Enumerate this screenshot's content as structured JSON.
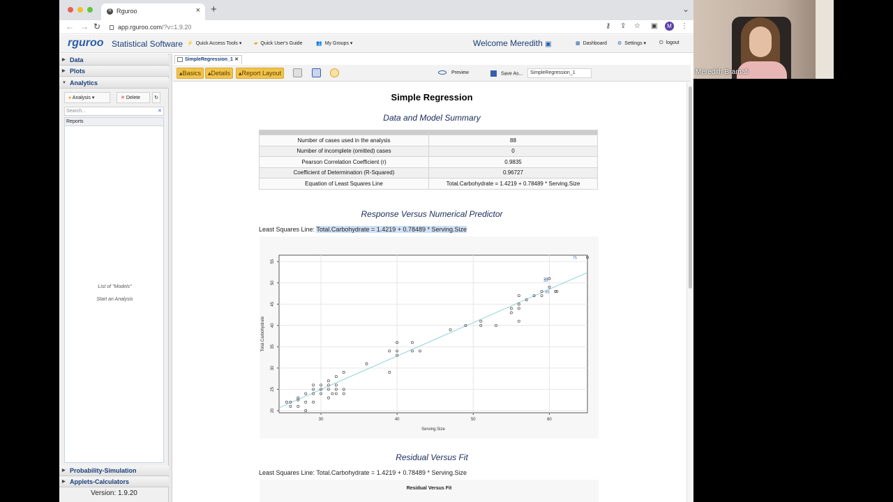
{
  "browser": {
    "tab_title": "Rguroo",
    "url_host": "app.rguroo.com",
    "url_path": "/?v=1.9.20"
  },
  "app": {
    "logo": "rguroo",
    "name": "Statistical Software",
    "quick_access": "Quick Access Tools",
    "users_guide": "Quick User's Guide",
    "my_groups": "My Groups",
    "welcome": "Welcome Meredith",
    "dashboard": "Dashboard",
    "settings": "Settings",
    "logout": "logout"
  },
  "sidebar": {
    "data": "Data",
    "plots": "Plots",
    "analytics": "Analytics",
    "analysis_btn": "Analysis",
    "delete_btn": "Delete",
    "search_placeholder": "Search...",
    "reports_header": "Reports",
    "empty_line1": "List of  \"Models\"",
    "empty_line2": "Start an Analysis",
    "prob_sim": "Probability-Simulation",
    "applets": "Applets-Calculators",
    "version": "Version: 1.9.20"
  },
  "document": {
    "tab_label": "SimpleRegression_1",
    "basics": "Basics",
    "details": "Details",
    "report_layout": "Report Layout",
    "preview": "Preview",
    "save_as": "Save As...",
    "filename": "SimpleRegression_1"
  },
  "report": {
    "title": "Simple Regression",
    "section1": "Data and Model Summary",
    "summary_rows": [
      {
        "label": "Number of cases used in the analysis",
        "value": "88"
      },
      {
        "label": "Number of incomplete (omitted) cases",
        "value": "0"
      },
      {
        "label": "Pearson Correlation Coefficient (r)",
        "value": "0.9835"
      },
      {
        "label": "Coefficient of Determination (R-Squared)",
        "value": "0.96727"
      },
      {
        "label": "Equation of Least Squares Line",
        "value": "Total.Carbohydrate = 1.4219 + 0.78489 * Serving.Size"
      }
    ],
    "section2": "Response Versus Numerical Predictor",
    "lsl_prefix": "Least Squares Line: ",
    "lsl_equation": "Total.Carbohydrate = 1.4219 + 0.78489 * Serving.Size",
    "section3": "Residual Versus Fit",
    "residual_plot_title": "Residual Versus Fit"
  },
  "webcam": {
    "name": "Meredith Bramati"
  },
  "chart_data": {
    "type": "scatter",
    "title": "",
    "xlabel": "Serving.Size",
    "ylabel": "Total.Carbohydrate",
    "xlim": [
      24.5,
      65
    ],
    "ylim": [
      19.5,
      56.5
    ],
    "xticks": [
      30,
      40,
      50,
      60
    ],
    "yticks": [
      20,
      25,
      30,
      35,
      40,
      45,
      50,
      55
    ],
    "grid": true,
    "fit_line": {
      "intercept": 1.4219,
      "slope": 0.78489,
      "color": "#8fd3d8"
    },
    "point_labels": [
      {
        "x": 60,
        "y": 50.9,
        "text": "29"
      },
      {
        "x": 60,
        "y": 50.6,
        "text": "33"
      },
      {
        "x": 60.2,
        "y": 47.9,
        "text": "65"
      },
      {
        "x": 63.8,
        "y": 55.9,
        "text": "75"
      }
    ],
    "points": [
      [
        25.5,
        22
      ],
      [
        26,
        22
      ],
      [
        26,
        21
      ],
      [
        27,
        23
      ],
      [
        27,
        22.5
      ],
      [
        27,
        21
      ],
      [
        28,
        22
      ],
      [
        28,
        20
      ],
      [
        28,
        24
      ],
      [
        29,
        22
      ],
      [
        29,
        24
      ],
      [
        29,
        25
      ],
      [
        29,
        26
      ],
      [
        30,
        24
      ],
      [
        30,
        25
      ],
      [
        30,
        26
      ],
      [
        31,
        23
      ],
      [
        31,
        25
      ],
      [
        31,
        26
      ],
      [
        31,
        27
      ],
      [
        31.5,
        24
      ],
      [
        32,
        25
      ],
      [
        32,
        26
      ],
      [
        32,
        28
      ],
      [
        32,
        24
      ],
      [
        33,
        24
      ],
      [
        33,
        25
      ],
      [
        33,
        29
      ],
      [
        36,
        31
      ],
      [
        39,
        29
      ],
      [
        39,
        34
      ],
      [
        40,
        33
      ],
      [
        40,
        34
      ],
      [
        40,
        36
      ],
      [
        42,
        34
      ],
      [
        42,
        36
      ],
      [
        43,
        34
      ],
      [
        47,
        39
      ],
      [
        49,
        40
      ],
      [
        51,
        40
      ],
      [
        51,
        41
      ],
      [
        53,
        40
      ],
      [
        55,
        43
      ],
      [
        55,
        44
      ],
      [
        56,
        41
      ],
      [
        56,
        44
      ],
      [
        56,
        45
      ],
      [
        56,
        47
      ],
      [
        57,
        46
      ],
      [
        58,
        47
      ],
      [
        59,
        47
      ],
      [
        59,
        48
      ],
      [
        60,
        49
      ],
      [
        60,
        51
      ],
      [
        60.8,
        48
      ],
      [
        61,
        48
      ],
      [
        65,
        56
      ]
    ]
  }
}
